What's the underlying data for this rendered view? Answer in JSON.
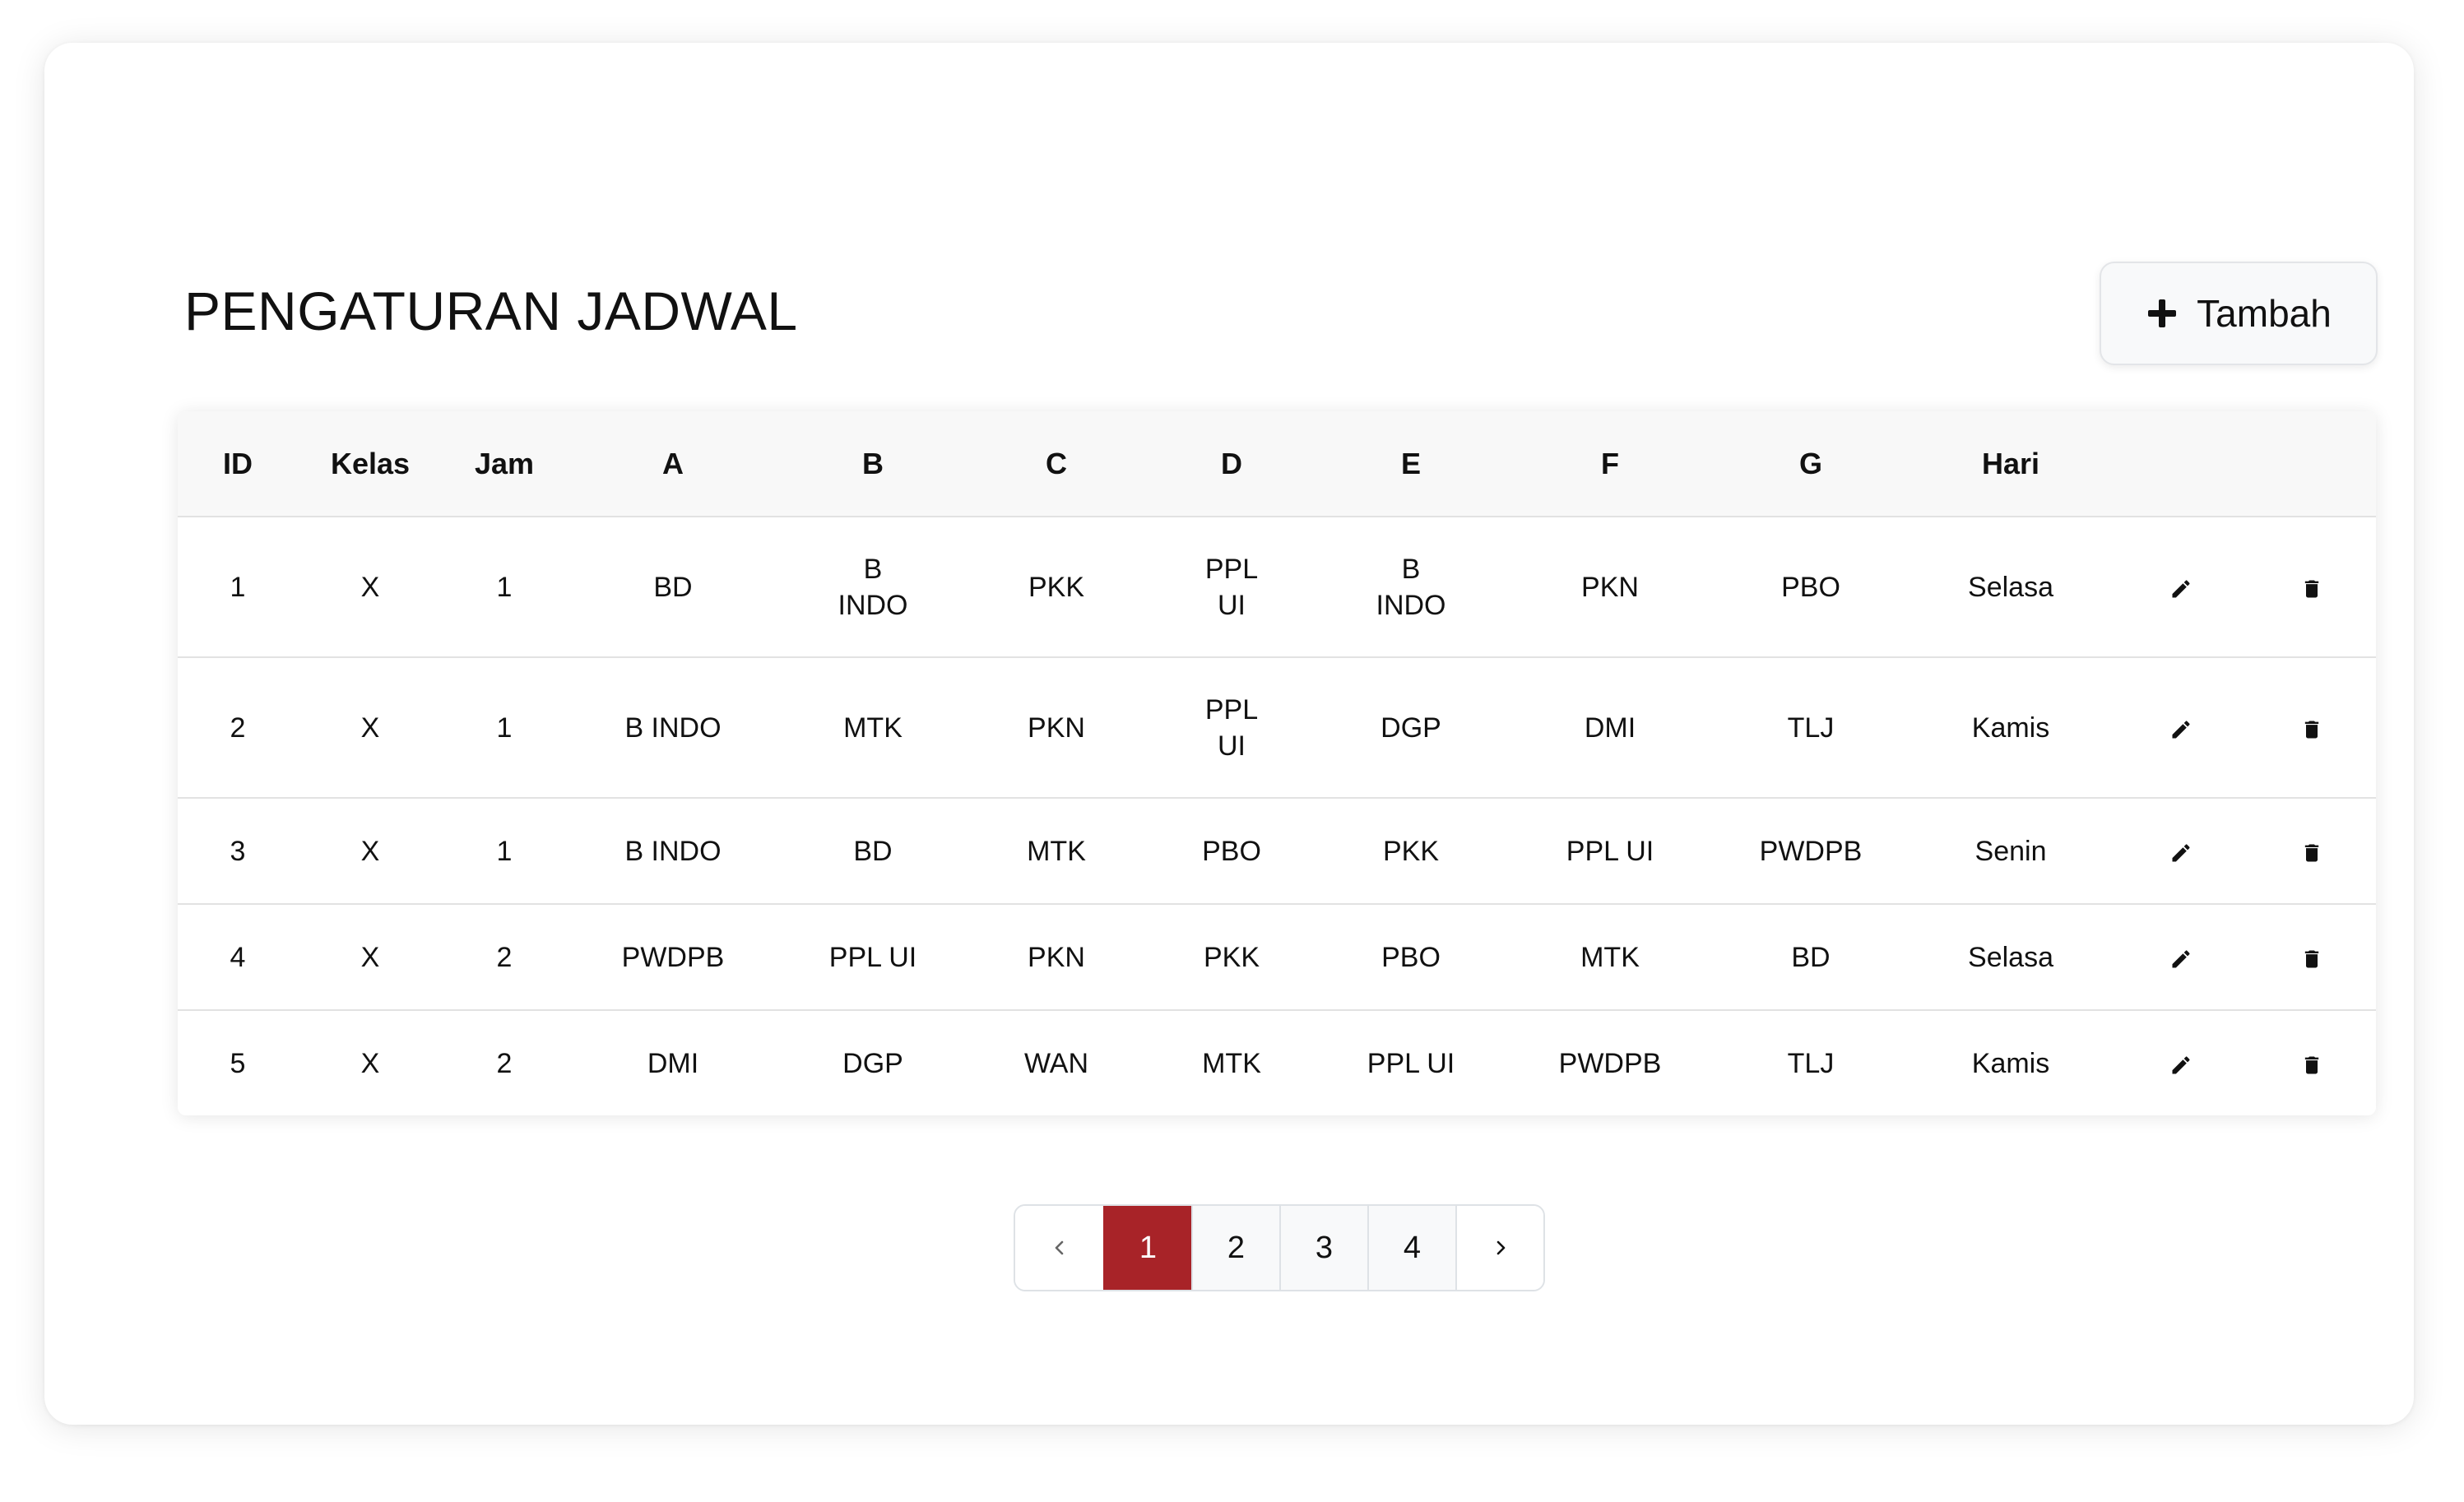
{
  "page": {
    "title": "PENGATURAN JADWAL",
    "add_button_label": "Tambah",
    "accent_color": "#a82328"
  },
  "table": {
    "headers": [
      "ID",
      "Kelas",
      "Jam",
      "A",
      "B",
      "C",
      "D",
      "E",
      "F",
      "G",
      "Hari",
      "",
      ""
    ],
    "rows": [
      {
        "id": "1",
        "kelas": "X",
        "jam": "1",
        "a": "BD",
        "b": "B INDO",
        "c": "PKK",
        "d": "PPL UI",
        "e": "B INDO",
        "f": "PKN",
        "g": "PBO",
        "hari": "Selasa"
      },
      {
        "id": "2",
        "kelas": "X",
        "jam": "1",
        "a": "B INDO",
        "b": "MTK",
        "c": "PKN",
        "d": "PPL UI",
        "e": "DGP",
        "f": "DMI",
        "g": "TLJ",
        "hari": "Kamis"
      },
      {
        "id": "3",
        "kelas": "X",
        "jam": "1",
        "a": "B INDO",
        "b": "BD",
        "c": "MTK",
        "d": "PBO",
        "e": "PKK",
        "f": "PPL UI",
        "g": "PWDPB",
        "hari": "Senin"
      },
      {
        "id": "4",
        "kelas": "X",
        "jam": "2",
        "a": "PWDPB",
        "b": "PPL UI",
        "c": "PKN",
        "d": "PKK",
        "e": "PBO",
        "f": "MTK",
        "g": "BD",
        "hari": "Selasa"
      },
      {
        "id": "5",
        "kelas": "X",
        "jam": "2",
        "a": "DMI",
        "b": "DGP",
        "c": "WAN",
        "d": "MTK",
        "e": "PPL UI",
        "f": "PWDPB",
        "g": "TLJ",
        "hari": "Kamis"
      }
    ],
    "row_action_icons": [
      "pencil-icon",
      "trash-icon"
    ]
  },
  "pagination": {
    "pages": [
      "1",
      "2",
      "3",
      "4"
    ],
    "current": "1",
    "prev_icon": "chevron-left-icon",
    "next_icon": "chevron-right-icon"
  }
}
